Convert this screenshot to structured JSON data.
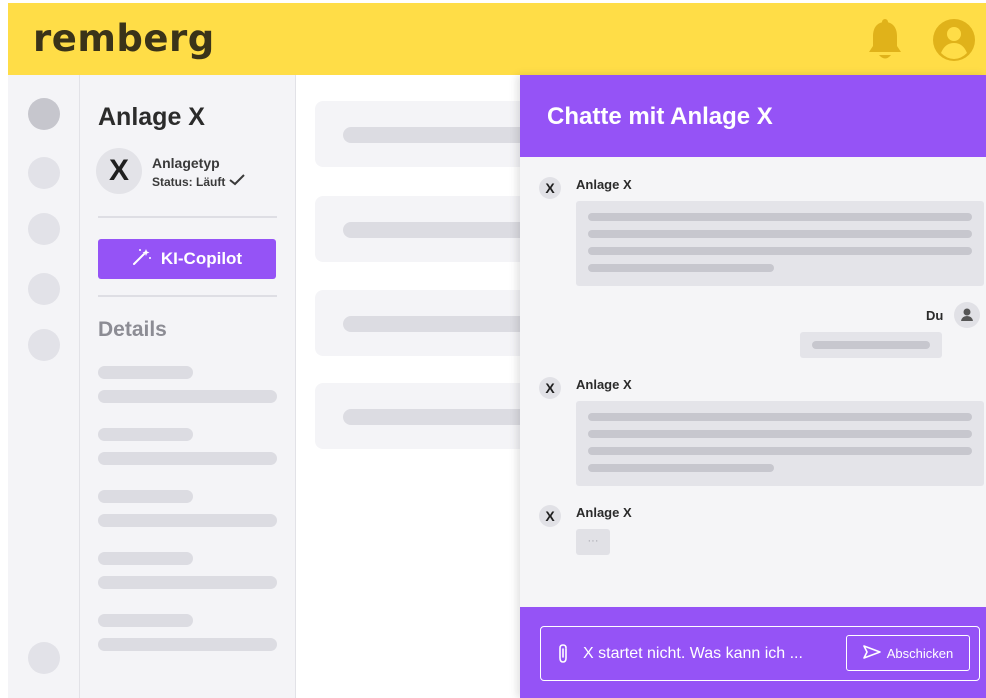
{
  "header": {
    "logo": "remberg",
    "icons": [
      "bell-icon",
      "account-icon"
    ],
    "colors": {
      "background": "#ffdd47",
      "logo": "#3a3319",
      "icon": "#e0b21a"
    }
  },
  "asset": {
    "name": "Anlage X",
    "avatar_letter": "X",
    "type": "Anlagetyp",
    "status": "Status: Läuft",
    "copilot_label": "KI-Copilot",
    "details_heading": "Details"
  },
  "chat": {
    "title": "Chatte mit Anlage X",
    "messages": [
      {
        "sender": "Anlage X",
        "avatar": "X"
      },
      {
        "sender": "Du"
      },
      {
        "sender": "Anlage X",
        "avatar": "X"
      },
      {
        "sender": "Anlage X",
        "avatar": "X",
        "typing": "···"
      }
    ],
    "input_value": "X startet nicht. Was kann ich ...",
    "send_label": "Abschicken",
    "colors": {
      "accent": "#9553f6"
    }
  }
}
